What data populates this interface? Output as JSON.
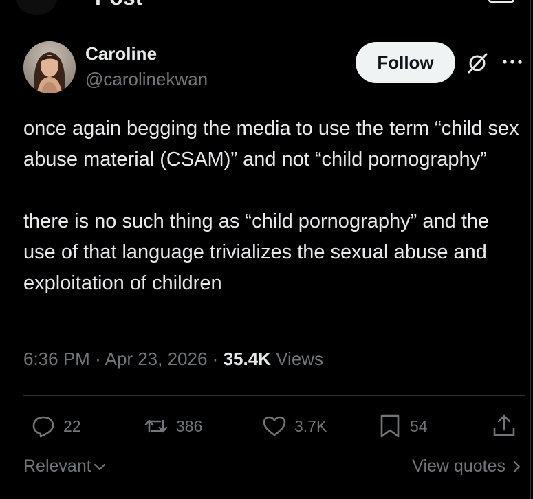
{
  "header": {
    "title": "Post"
  },
  "author": {
    "name": "Caroline",
    "handle": "@carolinekwan"
  },
  "follow_label": "Follow",
  "post": {
    "paragraphs": [
      "once again begging the media to use the term “child sex abuse material (CSAM)” and not “child pornography”",
      "there is no such thing as “child pornography” and the use of that language trivializes the sexual abuse and exploitation of children"
    ],
    "time": "6:36 PM",
    "date": "Apr 23, 2026",
    "separator": "·",
    "views_count": "35.4K",
    "views_label": "Views"
  },
  "actions": {
    "replies": "22",
    "reposts": "386",
    "likes": "3.7K",
    "bookmarks": "54"
  },
  "footer": {
    "sort_label": "Relevant",
    "quotes_label": "View quotes"
  },
  "icons": [
    "back-arrow-icon",
    "grok-icon",
    "more-icon",
    "reply-icon",
    "repost-icon",
    "like-icon",
    "bookmark-icon",
    "share-icon",
    "chevron-down-icon",
    "chevron-right-icon"
  ],
  "colors": {
    "background": "#000000",
    "text": "#e7e9ea",
    "muted": "#71767b",
    "follow_bg": "#eff3f4",
    "divider": "#2f3336"
  }
}
